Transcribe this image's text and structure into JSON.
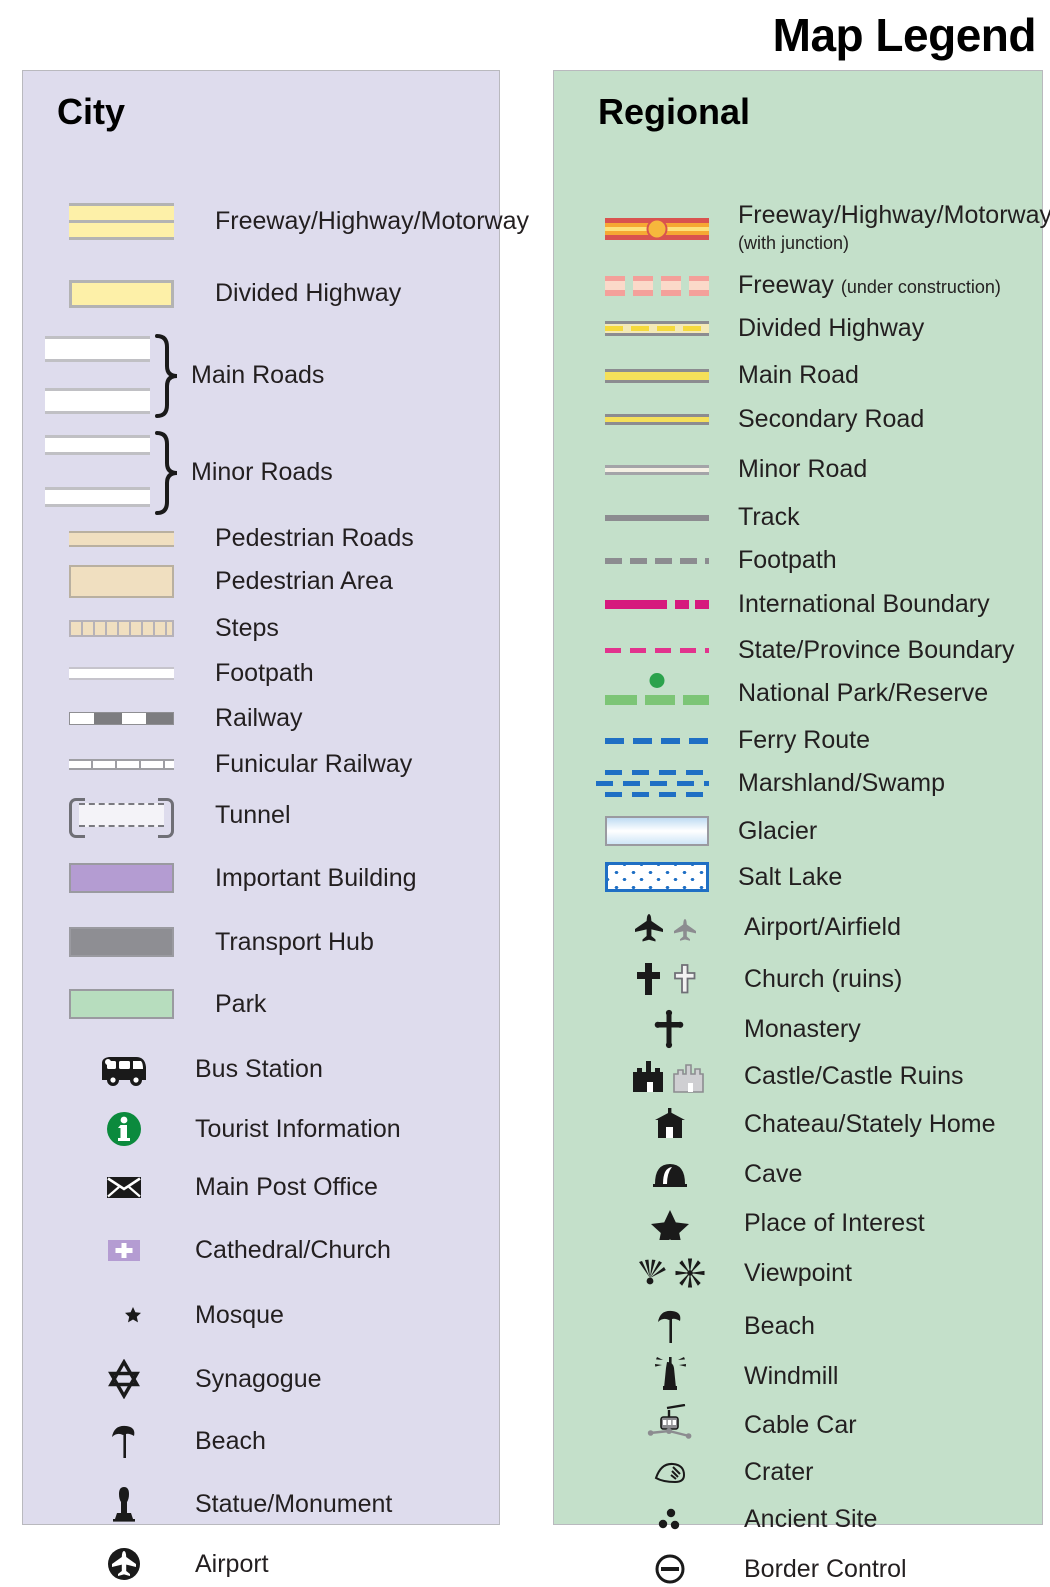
{
  "title": "Map Legend",
  "city": {
    "heading": "City",
    "items": [
      {
        "label": "Freeway/Highway/Motorway",
        "symbol": "freeway-double-band"
      },
      {
        "label": "Divided Highway",
        "symbol": "divided-highway-band"
      },
      {
        "label": "Main Roads",
        "symbol": "white-road-pair-braced"
      },
      {
        "label": "Minor Roads",
        "symbol": "white-road-pair-thin-braced"
      },
      {
        "label": "Pedestrian Roads",
        "symbol": "pedestrian-road-band"
      },
      {
        "label": "Pedestrian Area",
        "symbol": "pedestrian-area-block"
      },
      {
        "label": "Steps",
        "symbol": "steps-hatched-band"
      },
      {
        "label": "Footpath",
        "symbol": "footpath-thin-line"
      },
      {
        "label": "Railway",
        "symbol": "railway-dashed-block-line"
      },
      {
        "label": "Funicular Railway",
        "symbol": "funicular-ticked-line"
      },
      {
        "label": "Tunnel",
        "symbol": "tunnel-bracketed-dashed"
      },
      {
        "label": "Important Building",
        "symbol": "purple-block"
      },
      {
        "label": "Transport Hub",
        "symbol": "gray-block"
      },
      {
        "label": "Park",
        "symbol": "green-block"
      },
      {
        "label": "Bus Station",
        "symbol": "bus-icon"
      },
      {
        "label": "Tourist Information",
        "symbol": "information-circle-icon"
      },
      {
        "label": "Main Post Office",
        "symbol": "envelope-icon"
      },
      {
        "label": "Cathedral/Church",
        "symbol": "cross-on-purple-icon"
      },
      {
        "label": "Mosque",
        "symbol": "crescent-star-icon"
      },
      {
        "label": "Synagogue",
        "symbol": "star-of-david-icon"
      },
      {
        "label": "Beach",
        "symbol": "beach-umbrella-icon"
      },
      {
        "label": "Statue/Monument",
        "symbol": "statue-icon"
      },
      {
        "label": "Airport",
        "symbol": "airplane-circle-icon"
      }
    ]
  },
  "regional": {
    "heading": "Regional",
    "items": [
      {
        "label": "Freeway/Highway/Motorway",
        "sublabel": "(with junction)",
        "symbol": "freeway-junction-line"
      },
      {
        "label": "Freeway",
        "sublabel": "(under construction)",
        "symbol": "freeway-under-construction-line"
      },
      {
        "label": "Divided Highway",
        "symbol": "divided-highway-line"
      },
      {
        "label": "Main Road",
        "symbol": "main-road-line"
      },
      {
        "label": "Secondary Road",
        "symbol": "secondary-road-line"
      },
      {
        "label": "Minor Road",
        "symbol": "minor-road-line"
      },
      {
        "label": "Track",
        "symbol": "track-line"
      },
      {
        "label": "Footpath",
        "symbol": "footpath-dashed-line"
      },
      {
        "label": "International Boundary",
        "symbol": "international-boundary-line"
      },
      {
        "label": "State/Province Boundary",
        "symbol": "state-boundary-line"
      },
      {
        "label": "National Park/Reserve",
        "symbol": "national-park-line"
      },
      {
        "label": "Ferry Route",
        "symbol": "ferry-route-line"
      },
      {
        "label": "Marshland/Swamp",
        "symbol": "marshland-pattern"
      },
      {
        "label": "Glacier",
        "symbol": "glacier-block"
      },
      {
        "label": "Salt Lake",
        "symbol": "salt-lake-block"
      },
      {
        "label": "Airport/Airfield",
        "symbol": "airplane-pair-icon"
      },
      {
        "label": "Church (ruins)",
        "symbol": "cross-pair-icon"
      },
      {
        "label": "Monastery",
        "symbol": "monastery-cross-icon"
      },
      {
        "label": "Castle/Castle Ruins",
        "symbol": "castle-pair-icon"
      },
      {
        "label": "Chateau/Stately Home",
        "symbol": "chateau-icon"
      },
      {
        "label": "Cave",
        "symbol": "cave-icon"
      },
      {
        "label": "Place of Interest",
        "symbol": "star-icon"
      },
      {
        "label": "Viewpoint",
        "symbol": "viewpoint-pair-icon"
      },
      {
        "label": "Beach",
        "symbol": "beach-umbrella-icon"
      },
      {
        "label": "Windmill",
        "symbol": "windmill-icon"
      },
      {
        "label": "Cable Car",
        "symbol": "cable-car-icon"
      },
      {
        "label": "Crater",
        "symbol": "crater-icon"
      },
      {
        "label": "Ancient Site",
        "symbol": "ancient-site-dots-icon"
      },
      {
        "label": "Border Control",
        "symbol": "border-control-icon"
      }
    ]
  },
  "colors": {
    "city_panel_bg": "#dedced",
    "regional_panel_bg": "#c4e0ca",
    "highway_yellow": "#fdf0a8",
    "freeway_red": "#d9534f",
    "freeway_orange": "#f6a833",
    "pedestrian_tan": "#f0dfc0",
    "important_building_purple": "#b49cd2",
    "transport_hub_gray": "#8e8e93",
    "park_green": "#b7ddbe",
    "boundary_magenta": "#d6197d",
    "ferry_blue": "#1f6fc4",
    "national_park_green": "#7cc576",
    "text": "#231f20"
  }
}
